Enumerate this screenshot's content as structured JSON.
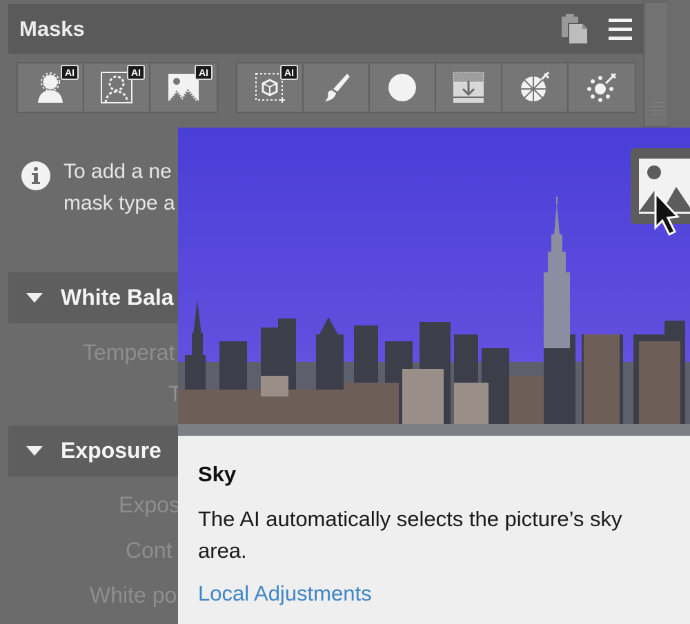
{
  "panel": {
    "title": "Masks",
    "header_icons": [
      "clipboard-copy-icon",
      "menu-icon"
    ],
    "tool_groups": [
      [
        {
          "name": "person-mask-icon",
          "ai": "AI"
        },
        {
          "name": "portrait-mask-icon",
          "ai": "AI"
        },
        {
          "name": "sky-mask-icon",
          "ai": "AI"
        }
      ],
      [
        {
          "name": "object-mask-icon",
          "ai": "AI"
        },
        {
          "name": "brush-icon"
        },
        {
          "name": "radial-gradient-icon"
        },
        {
          "name": "linear-gradient-icon"
        },
        {
          "name": "color-range-icon"
        },
        {
          "name": "luminance-range-icon"
        }
      ]
    ],
    "info": {
      "line1": "To add a ne",
      "line2": "mask type a"
    },
    "sections": [
      {
        "title": "White Bala",
        "params": [
          "Temperat",
          "T"
        ]
      },
      {
        "title": "Exposure",
        "params": [
          "Expos",
          "Cont",
          "White po"
        ]
      }
    ]
  },
  "tooltip": {
    "title": "Sky",
    "description": "The AI automatically selects the picture’s sky area.",
    "link": "Local Adjustments",
    "image_colors": {
      "sky": "#5b48dd",
      "sky_top": "#4a3ed8"
    }
  }
}
